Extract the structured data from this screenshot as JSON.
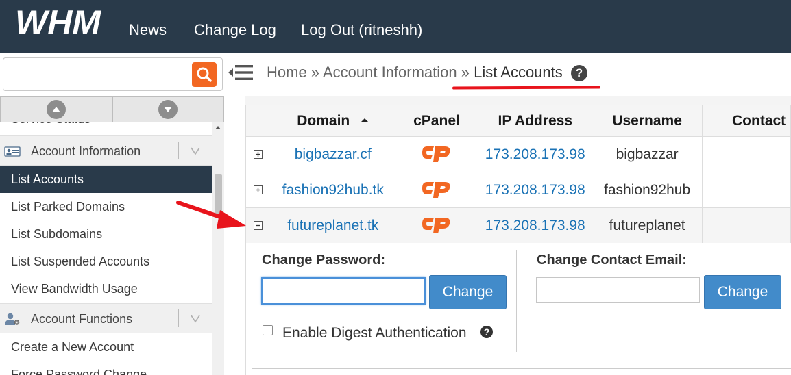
{
  "app": {
    "logo_text": "WHM",
    "colors": {
      "header_bg": "#293a4a",
      "accent_orange": "#f26722",
      "link_blue": "#1a72b5",
      "button_blue": "#428bca",
      "annotation_red": "#e8141c"
    }
  },
  "topnav": {
    "news": "News",
    "change_log": "Change Log",
    "logout": "Log Out (ritneshh)"
  },
  "search": {
    "value": "",
    "placeholder": "",
    "icon": "search-icon"
  },
  "sidebar": {
    "partial_top": "Service Status",
    "groups": [
      {
        "label": "Account Information",
        "icon": "id-card-icon"
      },
      {
        "label": "Account Functions",
        "icon": "user-gear-icon"
      }
    ],
    "items_account_information": [
      {
        "label": "List Accounts",
        "active": true
      },
      {
        "label": "List Parked Domains"
      },
      {
        "label": "List Subdomains"
      },
      {
        "label": "List Suspended Accounts"
      },
      {
        "label": "View Bandwidth Usage"
      }
    ],
    "items_account_functions": [
      {
        "label": "Create a New Account"
      },
      {
        "label": "Force Password Change"
      }
    ]
  },
  "breadcrumb": {
    "home": "Home",
    "sep": "»",
    "section": "Account Information",
    "current": "List Accounts",
    "help": "?"
  },
  "table": {
    "headers": {
      "domain": "Domain",
      "cpanel": "cPanel",
      "ip": "IP Address",
      "username": "Username",
      "contact": "Contact"
    },
    "sort": {
      "column": "Domain",
      "direction": "ascending"
    },
    "rows": [
      {
        "domain": "bigbazzar.cf",
        "cpanel": "cP",
        "ip": "173.208.173.98",
        "username": "bigbazzar",
        "contact": "",
        "expanded": false
      },
      {
        "domain": "fashion92hub.tk",
        "cpanel": "cP",
        "ip": "173.208.173.98",
        "username": "fashion92hub",
        "contact": "",
        "expanded": false
      },
      {
        "domain": "futureplanet.tk",
        "cpanel": "cP",
        "ip": "173.208.173.98",
        "username": "futureplanet",
        "contact": "",
        "expanded": true
      }
    ]
  },
  "expanded": {
    "change_password_label": "Change Password:",
    "password_value": "",
    "change_button": "Change",
    "digest_label": "Enable Digest Authentication",
    "digest_checked": false,
    "change_email_label": "Change Contact Email:",
    "email_value": "",
    "change_email_button": "Change"
  }
}
